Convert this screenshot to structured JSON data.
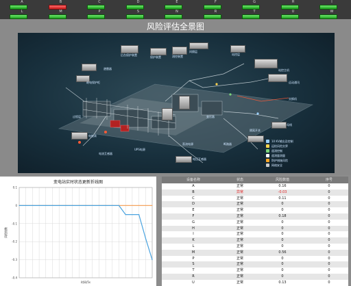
{
  "status_grid": [
    {
      "label": "A",
      "state": "green"
    },
    {
      "label": "B",
      "state": "red"
    },
    {
      "label": "C",
      "state": "green"
    },
    {
      "label": "D",
      "state": "green"
    },
    {
      "label": "E",
      "state": "green"
    },
    {
      "label": "F",
      "state": "green"
    },
    {
      "label": "G",
      "state": "green"
    },
    {
      "label": "H",
      "state": "green"
    },
    {
      "label": "I",
      "state": "green"
    },
    {
      "label": "L",
      "state": "green"
    },
    {
      "label": "M",
      "state": "green"
    },
    {
      "label": "P",
      "state": "green"
    },
    {
      "label": "S",
      "state": "green"
    },
    {
      "label": "N",
      "state": "green"
    },
    {
      "label": "R",
      "state": "green"
    },
    {
      "label": "T",
      "state": "green"
    },
    {
      "label": "U",
      "state": "green"
    },
    {
      "label": "W",
      "state": "green"
    }
  ],
  "risk_panel": {
    "title": "风险评估全景图",
    "legend": [
      {
        "label": "10 KV输出及控制",
        "color": "#9ad0ff"
      },
      {
        "label": "运检风险交界",
        "color": "#ffd54f"
      },
      {
        "label": "遥测控制",
        "color": "#7bd67b"
      },
      {
        "label": "遥测量测量",
        "color": "#ffffff"
      },
      {
        "label": "防护措施风险",
        "color": "#ffa726"
      },
      {
        "label": "网络安全",
        "color": "#cccccc"
      }
    ],
    "node_labels": [
      "后台保护装置",
      "保护装置",
      "测控装置",
      "继电保护柜",
      "站控层",
      "站控主机",
      "远动通讯",
      "交换机",
      "间隔层",
      "过程层",
      "电能表",
      "电流互感器",
      "电压互感器",
      "断路器",
      "隔离开关",
      "母线",
      "变压器",
      "避雷器",
      "直流电源",
      "UPS电源"
    ]
  },
  "chart": {
    "title": "变电站实时状态更新折线图",
    "ylabel": "风险指数",
    "xlabel": "时间/5s"
  },
  "chart_data": {
    "type": "line",
    "title": "变电站实时状态更新折线图",
    "xlabel": "时间/5s",
    "ylabel": "风险指数",
    "ylim": [
      -0.4,
      0.1
    ],
    "yticks": [
      "0.1",
      "0",
      "-0.1",
      "-0.2",
      "-0.3",
      "-0.4"
    ],
    "x": [
      0,
      1,
      2,
      3,
      4,
      5,
      6,
      7,
      8,
      9,
      10,
      11,
      12,
      13,
      14,
      15,
      16,
      17,
      18,
      19,
      20
    ],
    "series": [
      {
        "name": "",
        "color": "#f4a460",
        "values": [
          0,
          0,
          0,
          0,
          0,
          0,
          0,
          0,
          0,
          0,
          0,
          0,
          0,
          0,
          0,
          0,
          0,
          0,
          0,
          0,
          0
        ]
      },
      {
        "name": "",
        "color": "#4aa3df",
        "values": [
          0,
          0,
          0,
          0,
          0,
          0,
          0,
          0,
          0,
          0,
          0,
          0,
          0,
          0,
          0,
          0,
          -0.05,
          -0.05,
          -0.05,
          -0.18,
          -0.3
        ]
      }
    ]
  },
  "table": {
    "headers": [
      "设备名称",
      "状态",
      "风险数值",
      "序号"
    ],
    "rows": [
      [
        "A",
        "正常",
        "0.16",
        "0"
      ],
      [
        "B",
        "异常",
        "-0.03",
        "0"
      ],
      [
        "C",
        "正常",
        "0.11",
        "0"
      ],
      [
        "D",
        "正常",
        "0",
        "0"
      ],
      [
        "E",
        "正常",
        "0",
        "0"
      ],
      [
        "F",
        "正常",
        "0.18",
        "0"
      ],
      [
        "G",
        "正常",
        "0",
        "0"
      ],
      [
        "H",
        "正常",
        "0",
        "0"
      ],
      [
        "I",
        "正常",
        "0",
        "0"
      ],
      [
        "K",
        "正常",
        "0",
        "0"
      ],
      [
        "L",
        "正常",
        "0",
        "0"
      ],
      [
        "M",
        "正常",
        "0.56",
        "0"
      ],
      [
        "P",
        "正常",
        "0",
        "0"
      ],
      [
        "S",
        "正常",
        "0",
        "0"
      ],
      [
        "T",
        "正常",
        "0",
        "0"
      ],
      [
        "R",
        "正常",
        "0",
        "0"
      ],
      [
        "U",
        "正常",
        "0.13",
        "0"
      ]
    ]
  }
}
